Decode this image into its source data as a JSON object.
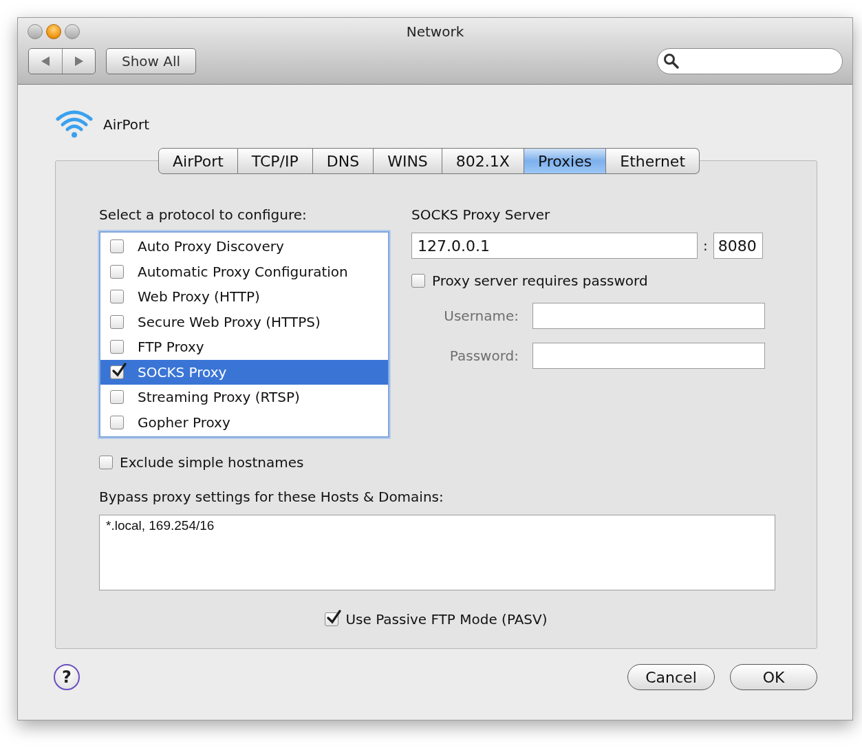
{
  "window": {
    "title": "Network"
  },
  "toolbar": {
    "show_all": "Show All"
  },
  "interface": {
    "name": "AirPort"
  },
  "tabs": [
    {
      "label": "AirPort",
      "selected": false
    },
    {
      "label": "TCP/IP",
      "selected": false
    },
    {
      "label": "DNS",
      "selected": false
    },
    {
      "label": "WINS",
      "selected": false
    },
    {
      "label": "802.1X",
      "selected": false
    },
    {
      "label": "Proxies",
      "selected": true
    },
    {
      "label": "Ethernet",
      "selected": false
    }
  ],
  "protocols": {
    "label": "Select a protocol to configure:",
    "items": [
      {
        "label": "Auto Proxy Discovery",
        "checked": false,
        "selected": false
      },
      {
        "label": "Automatic Proxy Configuration",
        "checked": false,
        "selected": false
      },
      {
        "label": "Web Proxy (HTTP)",
        "checked": false,
        "selected": false
      },
      {
        "label": "Secure Web Proxy (HTTPS)",
        "checked": false,
        "selected": false
      },
      {
        "label": "FTP Proxy",
        "checked": false,
        "selected": false
      },
      {
        "label": "SOCKS Proxy",
        "checked": true,
        "selected": true
      },
      {
        "label": "Streaming Proxy (RTSP)",
        "checked": false,
        "selected": false
      },
      {
        "label": "Gopher Proxy",
        "checked": false,
        "selected": false
      }
    ]
  },
  "server": {
    "title": "SOCKS Proxy Server",
    "host": "127.0.0.1",
    "separator": ":",
    "port": "8080"
  },
  "requires_password": {
    "label": "Proxy server requires password",
    "checked": false
  },
  "credentials": [
    {
      "label": "Username:",
      "disabled": true
    },
    {
      "label": "Password:",
      "disabled": true
    }
  ],
  "exclude_simple_hostnames": {
    "label": "Exclude simple hostnames",
    "checked": false
  },
  "bypass": {
    "label": "Bypass proxy settings for these Hosts & Domains:",
    "value": "*.local, 169.254/16"
  },
  "passive_ftp": {
    "label": "Use Passive FTP Mode (PASV)",
    "checked": true
  },
  "help": "?",
  "buttons": [
    {
      "label": "Cancel"
    },
    {
      "label": "OK"
    }
  ]
}
